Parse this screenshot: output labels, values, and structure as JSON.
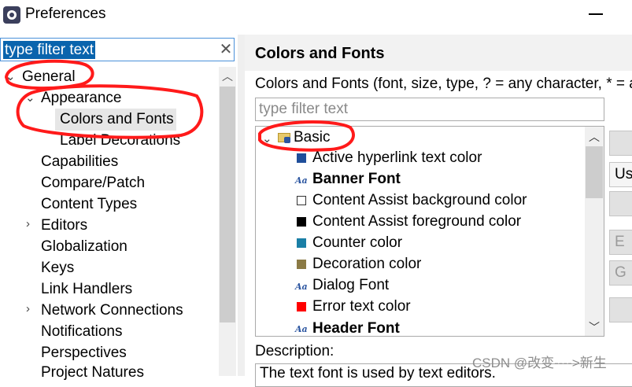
{
  "window": {
    "title": "Preferences"
  },
  "left": {
    "filter_text": "type filter text",
    "clear_glyph": "✕",
    "tree": [
      {
        "label": "General",
        "chevron": "⌄"
      },
      {
        "label": "Appearance",
        "chevron": "⌄"
      },
      {
        "label": "Colors and Fonts"
      },
      {
        "label": "Label Decorations"
      },
      {
        "label": "Capabilities"
      },
      {
        "label": "Compare/Patch"
      },
      {
        "label": "Content Types"
      },
      {
        "label": "Editors",
        "chevron": "›"
      },
      {
        "label": "Globalization"
      },
      {
        "label": "Keys"
      },
      {
        "label": "Link Handlers"
      },
      {
        "label": "Network Connections",
        "chevron": "›"
      },
      {
        "label": "Notifications"
      },
      {
        "label": "Perspectives"
      },
      {
        "label": "Project Natures"
      }
    ]
  },
  "right": {
    "title": "Colors and Fonts",
    "description": "Colors and Fonts (font, size, type, ? = any character, * = a",
    "filter_placeholder": "type filter text",
    "category": {
      "label": "Basic",
      "chevron": "⌄",
      "icon": "folder-font-icon"
    },
    "items": [
      {
        "label": "Active hyperlink text color",
        "kind": "color",
        "color": "#1f4e9a"
      },
      {
        "label": "Banner Font",
        "kind": "font",
        "bold": true
      },
      {
        "label": "Content Assist background color",
        "kind": "color",
        "color": "#ffffff"
      },
      {
        "label": "Content Assist foreground color",
        "kind": "color",
        "color": "#000000"
      },
      {
        "label": "Counter color",
        "kind": "color",
        "color": "#1a7fa6"
      },
      {
        "label": "Decoration color",
        "kind": "color",
        "color": "#8b7a45"
      },
      {
        "label": "Dialog Font",
        "kind": "font"
      },
      {
        "label": "Error text color",
        "kind": "color",
        "color": "#ff0000"
      },
      {
        "label": "Header Font",
        "kind": "font",
        "bold": true
      }
    ],
    "font_icon_text": "Aa",
    "desc_label": "Description:",
    "desc_text": "The text font is used by text editors.",
    "side_buttons": [
      "",
      "Use",
      "",
      "E",
      "G",
      ""
    ]
  },
  "watermark": "CSDN @改变---->新生",
  "colors": {
    "selection": "#0a64ad",
    "annotation": "#ff1a1a"
  }
}
